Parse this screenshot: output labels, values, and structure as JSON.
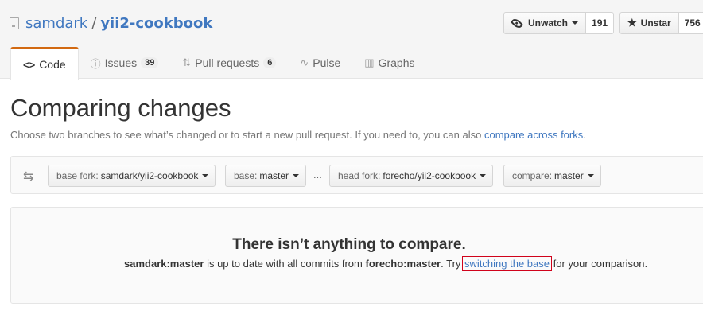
{
  "repo": {
    "owner": "samdark",
    "separator": "/",
    "name": "yii2-cookbook"
  },
  "actions": {
    "watch_label": "Unwatch",
    "watch_count": "191",
    "star_label": "Unstar",
    "star_count": "756"
  },
  "tabs": [
    {
      "label": "Code",
      "icon": "<>"
    },
    {
      "label": "Issues",
      "count": "39"
    },
    {
      "label": "Pull requests",
      "count": "6"
    },
    {
      "label": "Pulse"
    },
    {
      "label": "Graphs"
    }
  ],
  "page": {
    "title": "Comparing changes",
    "description": "Choose two branches to see what’s changed or to start a new pull request. If you need to, you can also",
    "description_link": "compare across forks",
    "description_end": "."
  },
  "range": {
    "base_fork_label": "base fork:",
    "base_fork_value": "samdark/yii2-cookbook",
    "base_label": "base:",
    "base_value": "master",
    "dots": "...",
    "head_fork_label": "head fork:",
    "head_fork_value": "forecho/yii2-cookbook",
    "compare_label": "compare:",
    "compare_value": "master"
  },
  "blankslate": {
    "title": "There isn’t anything to compare.",
    "base_ref": "samdark:master",
    "text_mid": "is up to date with all commits from",
    "head_ref": "forecho:master",
    "text_try": ". Try",
    "link": "switching the base",
    "text_end": "for your comparison."
  },
  "colors": {
    "link": "#4078c0",
    "tab_accent": "#d26911",
    "highlight_box": "#d0021b"
  }
}
